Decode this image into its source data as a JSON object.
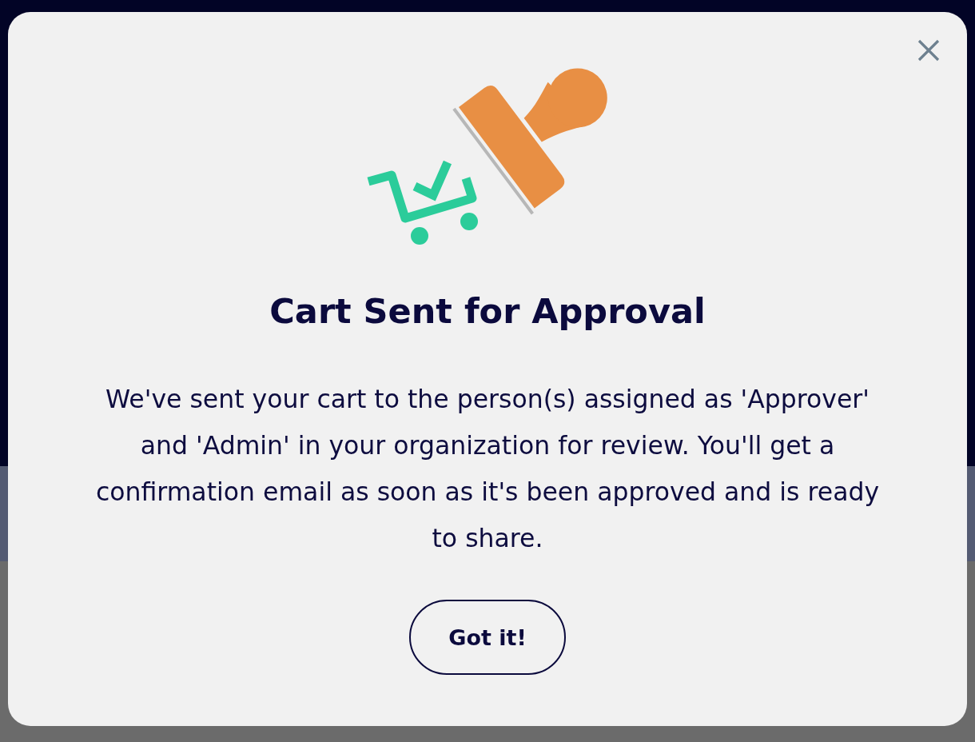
{
  "dialog": {
    "title": "Cart Sent for Approval",
    "message": "We've sent your cart to the person(s) assigned as 'Approver' and 'Admin' in your organization for review. You'll get a confirmation email as soon as it's been approved and is ready to share.",
    "button": "Got it!"
  }
}
